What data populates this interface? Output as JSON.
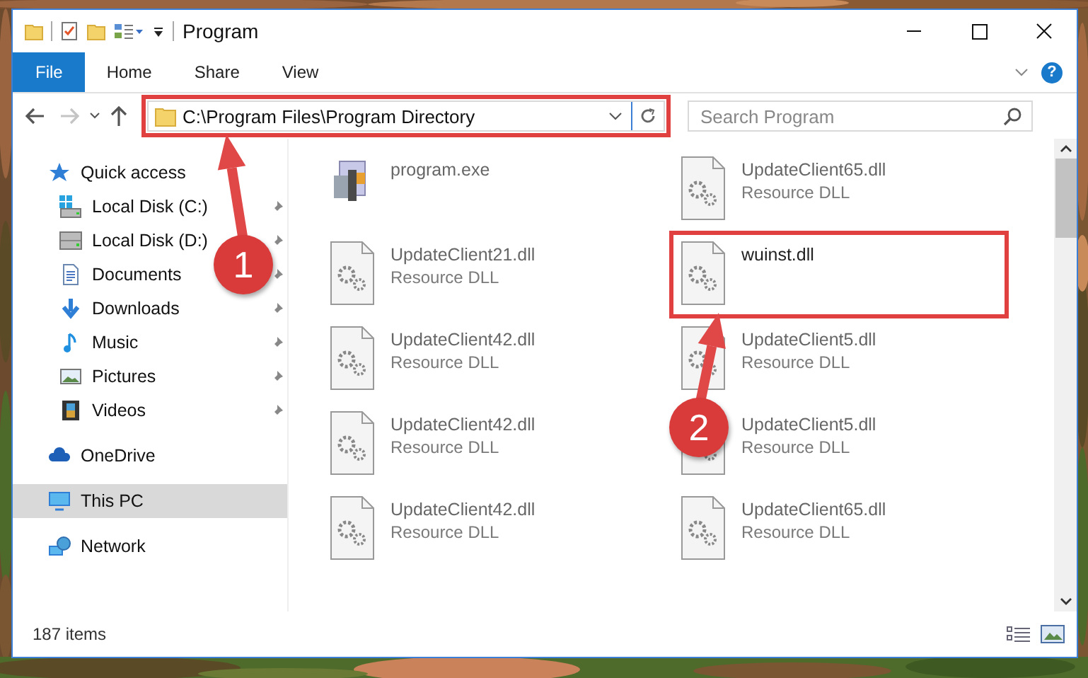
{
  "window": {
    "title": "Program"
  },
  "ribbon_tabs": [
    {
      "label": "File",
      "kind": "file"
    },
    {
      "label": "Home",
      "kind": "tab"
    },
    {
      "label": "Share",
      "kind": "tab"
    },
    {
      "label": "View",
      "kind": "tab"
    }
  ],
  "help": "?",
  "navigation": {
    "back_disabled": false,
    "forward_disabled": true
  },
  "address_bar": {
    "path": "C:\\Program Files\\Program Directory",
    "highlighted": true
  },
  "search": {
    "placeholder": "Search Program"
  },
  "sidebar": {
    "items": [
      {
        "label": "Quick access",
        "kind": "star",
        "selected": false,
        "children": [
          {
            "label": "Local Disk (C:)",
            "kind": "system-drive",
            "pinned": true,
            "selected": false
          },
          {
            "label": "Local Disk (D:)",
            "kind": "drive",
            "pinned": true,
            "selected": false
          },
          {
            "label": "Documents",
            "kind": "documents",
            "pinned": true,
            "selected": false
          },
          {
            "label": "Downloads",
            "kind": "downloads",
            "pinned": true,
            "selected": false
          },
          {
            "label": "Music",
            "kind": "music",
            "pinned": true,
            "selected": false
          },
          {
            "label": "Pictures",
            "kind": "pictures",
            "pinned": true,
            "selected": false
          },
          {
            "label": "Videos",
            "kind": "videos",
            "pinned": true,
            "selected": false
          }
        ]
      },
      {
        "label": "OneDrive",
        "kind": "cloud",
        "selected": false
      },
      {
        "label": "This PC",
        "kind": "pc",
        "selected": true
      },
      {
        "label": "Network",
        "kind": "network",
        "selected": false
      }
    ]
  },
  "files": [
    {
      "name": "program.exe",
      "kind": "exe",
      "blurred": true,
      "highlighted": false
    },
    {
      "name": "UpdateClient65.dll",
      "type": "Resource DLL",
      "kind": "dll",
      "blurred": true,
      "highlighted": false
    },
    {
      "name": "UpdateClient21.dll",
      "type": "Resource DLL",
      "kind": "dll",
      "blurred": true,
      "highlighted": false
    },
    {
      "name": "wuinst.dll",
      "kind": "dll",
      "blurred": false,
      "highlighted": true
    },
    {
      "name": "UpdateClient42.dll",
      "type": "Resource DLL",
      "kind": "dll",
      "blurred": true,
      "highlighted": false
    },
    {
      "name": "UpdateClient5.dll",
      "type": "Resource DLL",
      "kind": "dll",
      "blurred": true,
      "highlighted": false
    },
    {
      "name": "UpdateClient42.dll",
      "type": "Resource DLL",
      "kind": "dll",
      "blurred": true,
      "highlighted": false
    },
    {
      "name": "UpdateClient5.dll",
      "type": "Resource DLL",
      "kind": "dll",
      "blurred": true,
      "highlighted": false
    },
    {
      "name": "UpdateClient42.dll",
      "type": "Resource DLL",
      "kind": "dll",
      "blurred": true,
      "highlighted": false
    },
    {
      "name": "UpdateClient65.dll",
      "type": "Resource DLL",
      "kind": "dll",
      "blurred": true,
      "highlighted": false
    }
  ],
  "annotations": [
    {
      "kind": "arrow",
      "number": "1"
    },
    {
      "kind": "arrow",
      "number": "2"
    }
  ],
  "status_bar": {
    "item_count": "187 items"
  }
}
